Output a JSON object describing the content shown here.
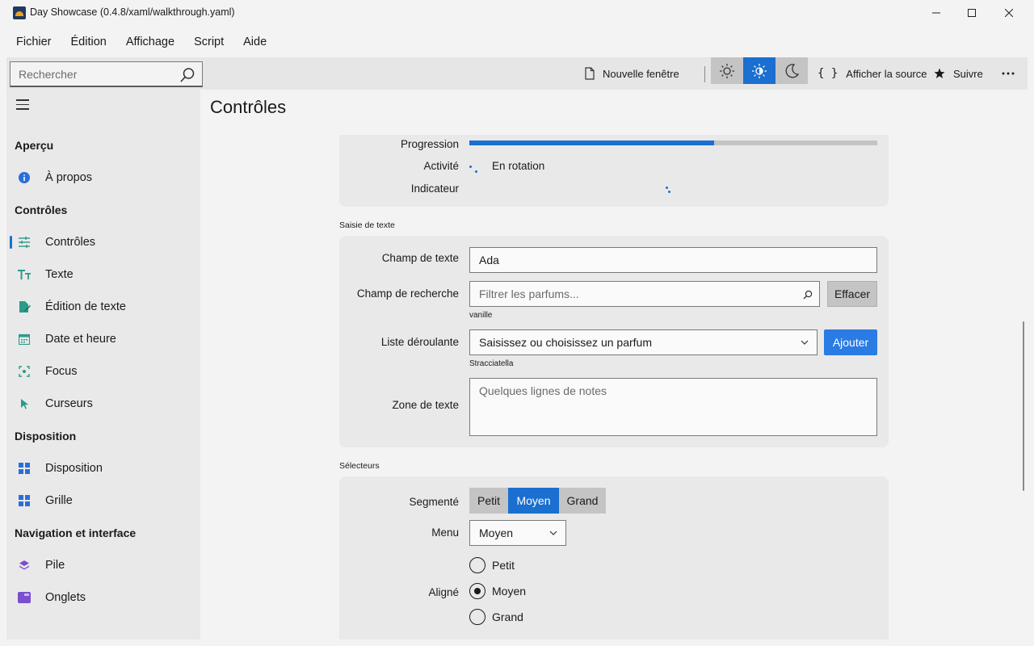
{
  "window": {
    "title": "Day Showcase (0.4.8/xaml/walkthrough.yaml)"
  },
  "menu": [
    "Fichier",
    "Édition",
    "Affichage",
    "Script",
    "Aide"
  ],
  "toolbar": {
    "search_placeholder": "Rechercher",
    "new_window": "Nouvelle fenêtre",
    "view_source": "Afficher la source",
    "follow": "Suivre"
  },
  "sidebar": {
    "sections": [
      {
        "title": "Aperçu",
        "items": [
          {
            "label": "À propos",
            "icon": "info-icon"
          }
        ]
      },
      {
        "title": "Contrôles",
        "items": [
          {
            "label": "Contrôles",
            "icon": "sliders-icon",
            "active": true
          },
          {
            "label": "Texte",
            "icon": "text-icon"
          },
          {
            "label": "Édition de texte",
            "icon": "edit-icon"
          },
          {
            "label": "Date et heure",
            "icon": "calendar-icon"
          },
          {
            "label": "Focus",
            "icon": "focus-icon"
          },
          {
            "label": "Curseurs",
            "icon": "cursor-icon"
          }
        ]
      },
      {
        "title": "Disposition",
        "items": [
          {
            "label": "Disposition",
            "icon": "layout-icon"
          },
          {
            "label": "Grille",
            "icon": "grid-icon"
          }
        ]
      },
      {
        "title": "Navigation et interface",
        "items": [
          {
            "label": "Pile",
            "icon": "stack-icon"
          },
          {
            "label": "Onglets",
            "icon": "tabs-icon"
          }
        ]
      }
    ]
  },
  "page": {
    "title": "Contrôles"
  },
  "progress": {
    "progress_label": "Progression",
    "progress_value": 0.6,
    "activity_label": "Activité",
    "activity_text": "En rotation",
    "indicator_label": "Indicateur"
  },
  "text_input": {
    "group_title": "Saisie de texte",
    "text_field_label": "Champ de texte",
    "text_field_value": "Ada",
    "search_field_label": "Champ de recherche",
    "search_field_placeholder": "Filtrer les parfums...",
    "clear_button": "Effacer",
    "search_caption": "vanille",
    "dropdown_label": "Liste déroulante",
    "dropdown_value": "Saisissez ou choisissez un parfum",
    "add_button": "Ajouter",
    "dropdown_caption": "Stracciatella",
    "textarea_label": "Zone de texte",
    "textarea_placeholder": "Quelques lignes de notes"
  },
  "selectors": {
    "group_title": "Sélecteurs",
    "segmented_label": "Segmenté",
    "segments": [
      "Petit",
      "Moyen",
      "Grand"
    ],
    "segment_selected": "Moyen",
    "menu_label": "Menu",
    "menu_value": "Moyen",
    "aligned_label": "Aligné",
    "radios": [
      "Petit",
      "Moyen",
      "Grand"
    ],
    "radio_selected": "Moyen"
  },
  "colors": {
    "accent": "#1a6fd0",
    "accent_button": "#2a7be4"
  }
}
